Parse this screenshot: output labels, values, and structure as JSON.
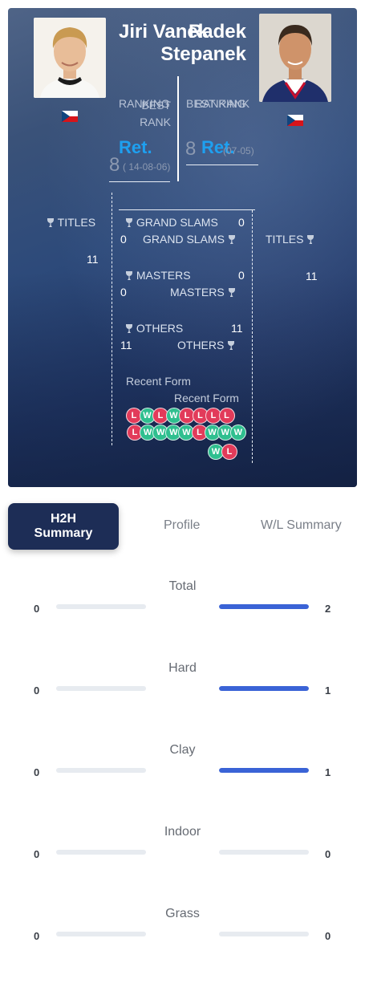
{
  "players": {
    "p1": {
      "name": "Jiri Vanek",
      "country_flag": "czech-flag",
      "ranking_label": "RANKING",
      "best_rank_label": "BEST RANK",
      "ranking_value": "Ret.",
      "best_rank_value": "8",
      "best_rank_date": "( 14-08-06)",
      "titles_label": "TITLES",
      "titles_value": "11"
    },
    "p2": {
      "name": "Radek Stepanek",
      "name_line1": "Radek",
      "name_line2": "Stepanek",
      "country_flag": "czech-flag",
      "ranking_label": "RANKING",
      "best_rank_label": "BEST RANK",
      "ranking_value": "Ret.",
      "best_rank_value": "8",
      "best_rank_date": "(07-05)",
      "titles_label": "TITLES",
      "titles_value": "11"
    }
  },
  "stats": {
    "grand_slams_label": "GRAND SLAMS",
    "p1_grand_slams": "0",
    "p2_grand_slams": "0",
    "masters_label": "MASTERS",
    "p1_masters": "0",
    "p2_masters": "0",
    "others_label": "OTHERS",
    "p1_others": "11",
    "p2_others": "11",
    "recent_form_label": "Recent Form"
  },
  "recent_form": {
    "p1": [
      "L",
      "W",
      "L",
      "W",
      "L",
      "L",
      "L",
      "L"
    ],
    "p2_row1": [
      "L",
      "W",
      "W",
      "W",
      "W",
      "L",
      "W",
      "W",
      "W"
    ],
    "p2_row2": [
      "W",
      "L"
    ]
  },
  "tabs": {
    "h2h": "H2H Summary",
    "profile": "Profile",
    "wl_summary": "W/L Summary"
  },
  "h2h": [
    {
      "label": "Total",
      "p1": "0",
      "p2": "2",
      "p1_frac": 0,
      "p2_frac": 1
    },
    {
      "label": "Hard",
      "p1": "0",
      "p2": "1",
      "p1_frac": 0,
      "p2_frac": 1
    },
    {
      "label": "Clay",
      "p1": "0",
      "p2": "1",
      "p1_frac": 0,
      "p2_frac": 1
    },
    {
      "label": "Indoor",
      "p1": "0",
      "p2": "0",
      "p1_frac": 0,
      "p2_frac": 0
    },
    {
      "label": "Grass",
      "p1": "0",
      "p2": "0",
      "p1_frac": 0,
      "p2_frac": 0
    }
  ],
  "colors": {
    "win": "#2fbf8f",
    "loss": "#e23b5a",
    "bar": "#3a63d6",
    "hero_dark": "#1d2d56",
    "accent": "#1ea0f0"
  }
}
